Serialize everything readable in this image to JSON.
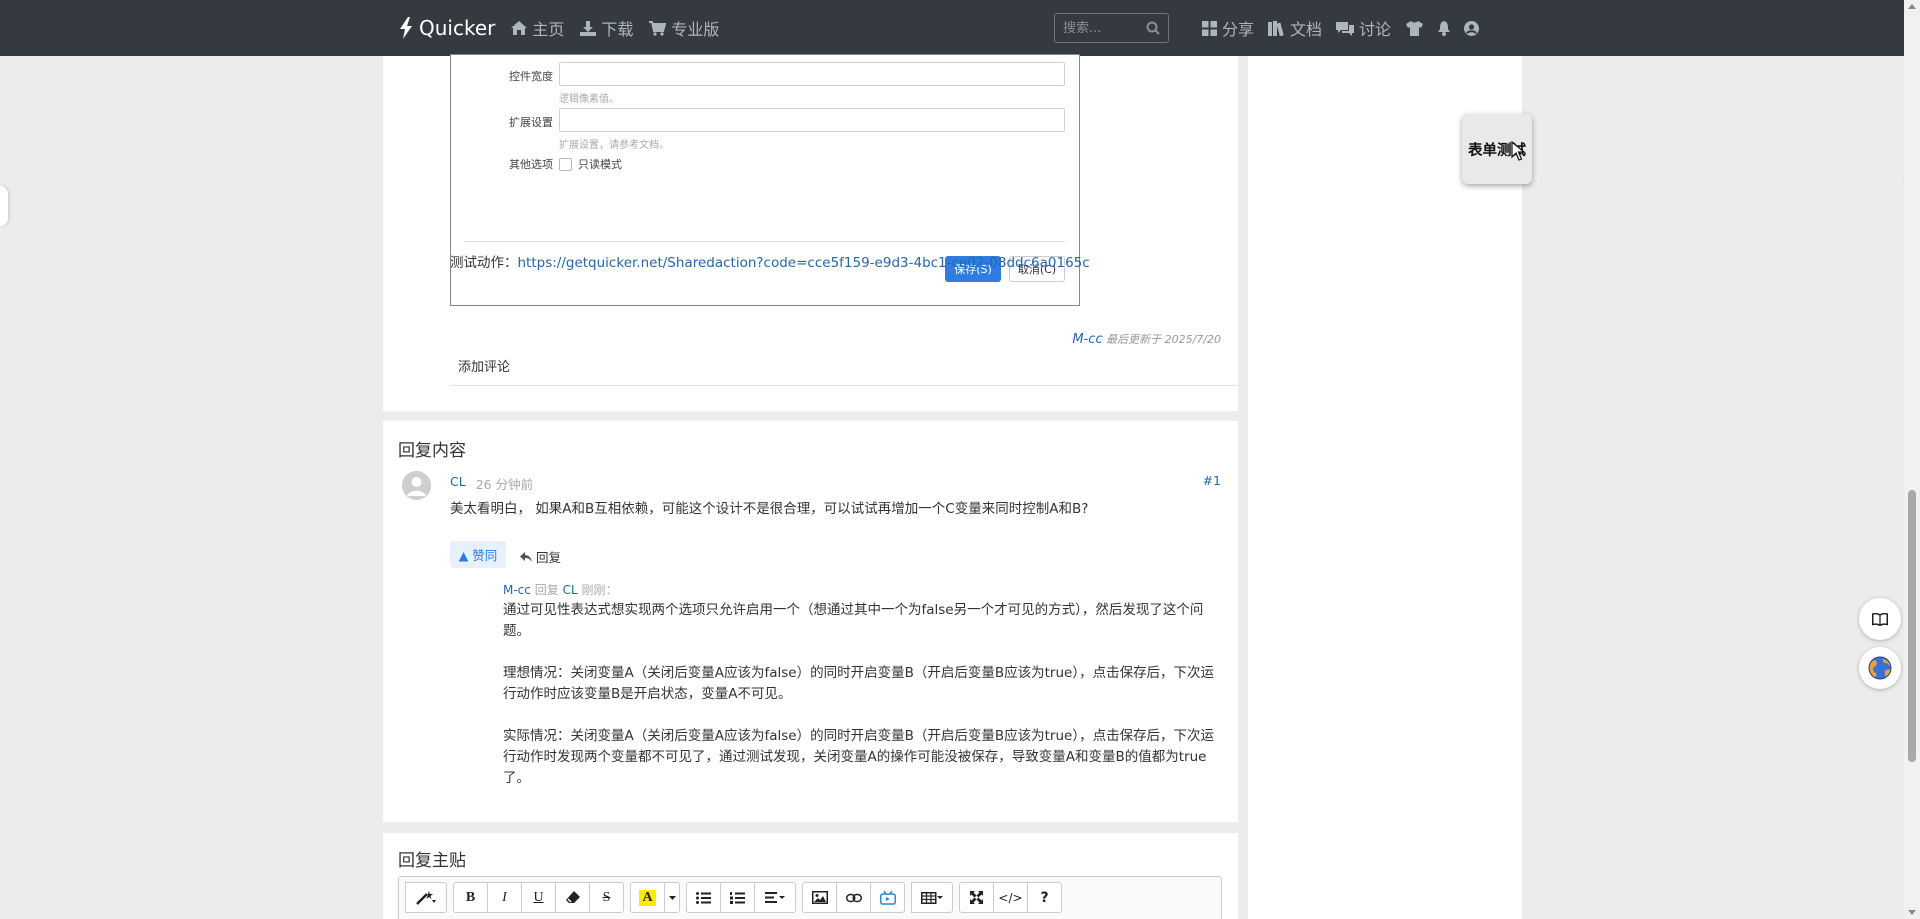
{
  "navbar": {
    "brand": "Quicker",
    "links": {
      "home": "主页",
      "download": "下载",
      "pro": "专业版",
      "share": "分享",
      "docs": "文档",
      "discuss": "讨论"
    },
    "search_placeholder": "搜索..."
  },
  "form_preview": {
    "width_label": "控件宽度",
    "width_hint": "逻辑像素值。",
    "ext_label": "扩展设置",
    "ext_hint": "扩展设置，请参考文档。",
    "other_label": "其他选项",
    "readonly_label": "只读模式",
    "save_label": "保存(S)",
    "cancel_label": "取消(C)"
  },
  "post": {
    "test_prefix": "测试动作：",
    "test_link": "https://getquicker.net/Sharedaction?code=cce5f159-e9d3-4bc1-ce02-08ddc6a0165c",
    "meta_author": "M-cc",
    "meta_text": "最后更新于 2025/7/20",
    "add_comment": "添加评论"
  },
  "replies": {
    "title": "回复内容",
    "items": [
      {
        "user": "CL",
        "time": "26 分钟前",
        "number": "#1",
        "body": "美太看明白， 如果A和B互相依赖，可能这个设计不是很合理，可以试试再增加一个C变量来同时控制A和B?",
        "vote_label": "▲ 赞同",
        "reply_label": "回复",
        "sub": {
          "user": "M-cc",
          "reply_word": "回复",
          "target": "CL",
          "time": "刚刚：",
          "paragraphs": [
            "通过可见性表达式想实现两个选项只允许启用一个（想通过其中一个为false另一个才可见的方式），然后发现了这个问题。",
            "理想情况：关闭变量A（关闭后变量A应该为false）的同时开启变量B（开启后变量B应该为true），点击保存后，下次运行动作时应该变量B是开启状态，变量A不可见。",
            "实际情况：关闭变量A（关闭后变量A应该为false）的同时开启变量B（开启后变量B应该为true），点击保存后，下次运行动作时发现两个变量都不可见了，通过测试发现，关闭变量A的操作可能没被保存，导致变量A和变量B的值都为true了。"
          ]
        }
      }
    ]
  },
  "reply_post": {
    "title": "回复主贴",
    "toolbar": {
      "bold": "B",
      "italic": "I",
      "underline": "U",
      "strike": "S",
      "color": "A",
      "code": "</>",
      "help": "?"
    }
  },
  "floating": {
    "label": "表单测试"
  },
  "colors": {
    "navbar_bg": "#343a40",
    "link": "#2567a8",
    "primary": "#2f7de1"
  }
}
